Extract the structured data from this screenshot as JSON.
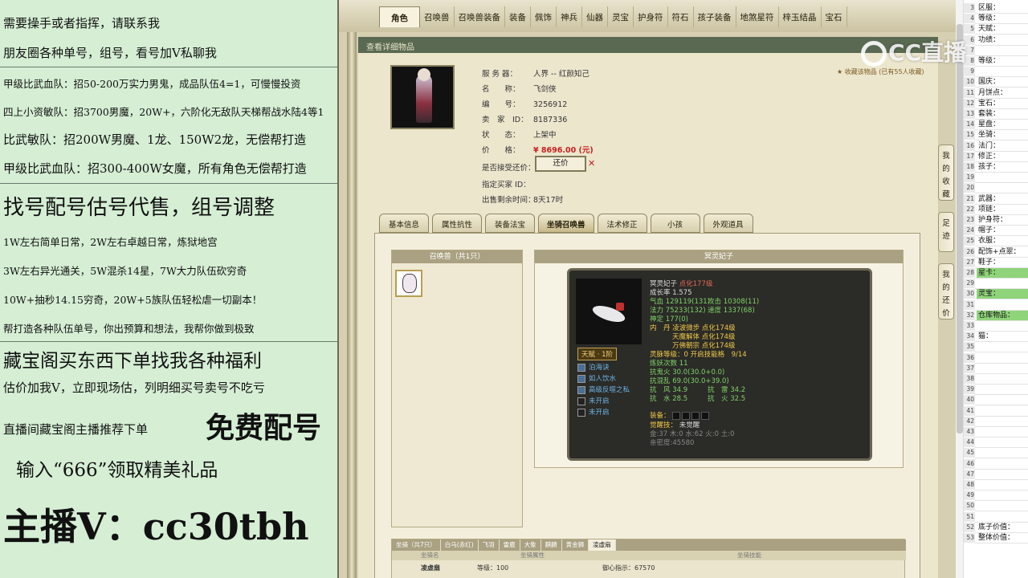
{
  "promo": {
    "lines": [
      "需要操手或者指挥，请联系我",
      "朋友圈各种单号，组号，看号加Ⅴ私聊我",
      "甲级比武血队：招50-200万实力男鬼，成品队伍4=1，可慢慢投资",
      "四上小资敏队：招3700男魔，20W+，六阶化无敌队天梯帮战水陆4等1",
      "比武敏队：招200W男魔、1龙、150W2龙，无偿帮打造",
      "甲级比武血队：招300-400W女魔，所有角色无偿帮打造",
      "找号配号估号代售，组号调整",
      "1W左右简单日常，2W左右卓越日常，炼狱地宫",
      "3W左右异光通关，5W混杀14星，7W大力队伍砍穷奇",
      "10W+抽秒14.15穷奇，20W+5族队伍轻松虐一切副本！",
      "帮打造各种队伍单号，你出预算和想法，我帮你做到极致",
      "藏宝阁买东西下单找我各种福利",
      "估价加我Ⅴ，立即现场估，列明细买号卖号不吃亏",
      "直播间藏宝阁主播推荐下单",
      "免费配号",
      "输入“666”领取精美礼品",
      "主播Ⅴ：cc30tbh"
    ]
  },
  "game": {
    "top_tabs": [
      "角色",
      "召唤兽",
      "召唤兽装备",
      "装备",
      "佩饰",
      "神兵",
      "仙器",
      "灵宝",
      "护身符",
      "符石",
      "孩子装备",
      "地煞星符",
      "梓玉结晶",
      "宝石"
    ],
    "panel_title": "查看详细物品",
    "favorite_text": "收藏该物品 (已有55人收藏)",
    "info": {
      "server_label": "服 务 器：",
      "server": "人界 -- 红颜知己",
      "name_label": "名　　称：",
      "name": "飞剑侠",
      "id_label": "编　　号：",
      "id": "3256912",
      "seller_label": "卖　家　ID：",
      "seller": "8187336",
      "status_label": "状　　态：",
      "status": "上架中",
      "price_label": "价　　格：",
      "price": "¥ 8696.00 (元)",
      "haggle_label": "是否接受还价：",
      "haggle_button": "还价",
      "haggle_close": "✕",
      "buyer_label": "指定买家 ID：",
      "remain_label": "出售剩余时间：",
      "remain": "8天17时"
    },
    "sub_tabs": [
      "基本信息",
      "属性抗性",
      "装备法宝",
      "坐骑召唤兽",
      "法术修正",
      "小孩",
      "外观道具"
    ],
    "pet_list_title": "召唤兽（共1只）",
    "pet_detail_title": "冥灵妃子",
    "pet": {
      "name": "冥灵妃子",
      "tag": "点化177级",
      "growth": "成长率 1.575",
      "line1_a": "气血 129119(131)",
      "line1_b": "攻击 10308(11)",
      "line2_a": "法力 75233(132)",
      "line2_b": "速度 1337(68)",
      "line3": "神定 177(0)",
      "neidan1": "内　丹 凌波微步 点化174级",
      "neidan2": "天魔解体 点化174级",
      "neidan3": "万佛朝宗 点化174级",
      "awaken": "灵脉等级：0 开启技能格　9/14",
      "demon": "炼妖次数 11",
      "resist1": "抗鬼火 30.0(30.0+0.0)",
      "resist2": "抗混乱 69.0(30.0+39.0)",
      "resist3_a": "抗　风 34.9",
      "resist3_b": "抗　雷 34.2",
      "resist4_a": "抗　水 28.5",
      "resist4_b": "抗　火 32.5",
      "equip_label": "装备：",
      "awaken_skill": "觉醒技：",
      "awaken_skill_val": "未觉醒",
      "elements": "金:37 木:0 水:62 火:0 土:0",
      "affinity": "亲密度:45580",
      "talent": "天赋 · 1阶",
      "skills": [
        "泊海诀",
        "如人饮水",
        "高级反噬之私",
        "未开启",
        "未开启"
      ]
    },
    "mount": {
      "tabs": [
        "坐骑（共7只）",
        "白马(赤红)",
        "飞羽",
        "雷鹿",
        "大象",
        "麒麟",
        "黄金狮",
        "凌虚扇"
      ],
      "col1": "坐骑名",
      "col2": "坐骑属性",
      "col3": "坐骑技能",
      "row_name": "凌虚扇",
      "row_level": "等级：100",
      "row_stat": "御心指示：67570"
    },
    "side_buttons": [
      "我的收藏",
      "足迹",
      "我的还价"
    ]
  },
  "sheet": {
    "rows": [
      {
        "n": "3",
        "v": "区服：",
        "hl": false
      },
      {
        "n": "4",
        "v": "等级：",
        "hl": false
      },
      {
        "n": "5",
        "v": "天赋：",
        "hl": false
      },
      {
        "n": "6",
        "v": "功绩：",
        "hl": false
      },
      {
        "n": "7",
        "v": "",
        "hl": false
      },
      {
        "n": "8",
        "v": "等级：",
        "hl": false
      },
      {
        "n": "9",
        "v": "",
        "hl": false
      },
      {
        "n": "10",
        "v": "国庆：",
        "hl": false
      },
      {
        "n": "11",
        "v": "月饼点：",
        "hl": false
      },
      {
        "n": "12",
        "v": "宝石：",
        "hl": false
      },
      {
        "n": "13",
        "v": "套装：",
        "hl": false
      },
      {
        "n": "14",
        "v": "星盘：",
        "hl": false
      },
      {
        "n": "15",
        "v": "坐骑：",
        "hl": false
      },
      {
        "n": "16",
        "v": "法门：",
        "hl": false
      },
      {
        "n": "17",
        "v": "修正：",
        "hl": false
      },
      {
        "n": "18",
        "v": "孩子：",
        "hl": false
      },
      {
        "n": "19",
        "v": "",
        "hl": false
      },
      {
        "n": "20",
        "v": "",
        "hl": false
      },
      {
        "n": "21",
        "v": "武器：",
        "hl": false
      },
      {
        "n": "22",
        "v": "项链：",
        "hl": false
      },
      {
        "n": "23",
        "v": "护身符：",
        "hl": false
      },
      {
        "n": "24",
        "v": "帽子：",
        "hl": false
      },
      {
        "n": "25",
        "v": "衣服：",
        "hl": false
      },
      {
        "n": "26",
        "v": "配饰+点翠：",
        "hl": false
      },
      {
        "n": "27",
        "v": "鞋子：",
        "hl": false
      },
      {
        "n": "28",
        "v": "星卡：",
        "hl": true
      },
      {
        "n": "29",
        "v": "",
        "hl": false
      },
      {
        "n": "30",
        "v": "灵宝：",
        "hl": true
      },
      {
        "n": "31",
        "v": "",
        "hl": false
      },
      {
        "n": "32",
        "v": "仓库物品：",
        "hl": true
      },
      {
        "n": "33",
        "v": "",
        "hl": false
      },
      {
        "n": "34",
        "v": "猫：",
        "hl": false
      },
      {
        "n": "35",
        "v": "",
        "hl": false
      },
      {
        "n": "36",
        "v": "",
        "hl": false
      },
      {
        "n": "37",
        "v": "",
        "hl": false
      },
      {
        "n": "38",
        "v": "",
        "hl": false
      },
      {
        "n": "39",
        "v": "",
        "hl": false
      },
      {
        "n": "40",
        "v": "",
        "hl": false
      },
      {
        "n": "41",
        "v": "",
        "hl": false
      },
      {
        "n": "42",
        "v": "",
        "hl": false
      },
      {
        "n": "43",
        "v": "",
        "hl": false
      },
      {
        "n": "44",
        "v": "",
        "hl": false
      },
      {
        "n": "45",
        "v": "",
        "hl": false
      },
      {
        "n": "46",
        "v": "",
        "hl": false
      },
      {
        "n": "47",
        "v": "",
        "hl": false
      },
      {
        "n": "48",
        "v": "",
        "hl": false
      },
      {
        "n": "49",
        "v": "",
        "hl": false
      },
      {
        "n": "50",
        "v": "",
        "hl": false
      },
      {
        "n": "51",
        "v": "",
        "hl": false
      },
      {
        "n": "52",
        "v": "底子价值：",
        "hl": false
      },
      {
        "n": "53",
        "v": "整体价值：",
        "hl": false
      }
    ]
  },
  "watermark": "CC直播"
}
